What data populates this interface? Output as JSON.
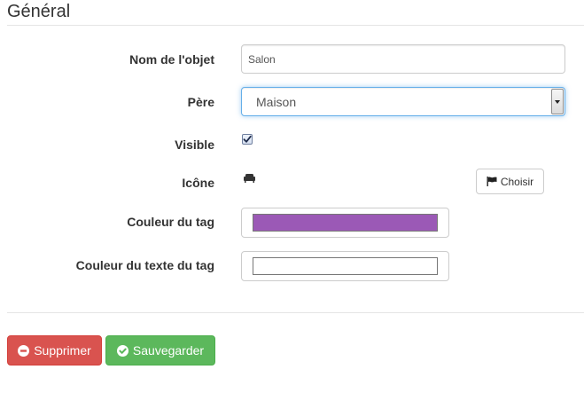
{
  "section": {
    "title": "Général"
  },
  "form": {
    "name": {
      "label": "Nom de l'objet",
      "value": "Salon"
    },
    "parent": {
      "label": "Père",
      "selected": "Maison"
    },
    "visible": {
      "label": "Visible",
      "checked": true
    },
    "icon": {
      "label": "Icône",
      "current_icon": "sofa-icon",
      "choose_label": "Choisir",
      "choose_icon": "flag-icon"
    },
    "tag_color": {
      "label": "Couleur du tag",
      "value": "#9b59b6"
    },
    "tag_text_color": {
      "label": "Couleur du texte du tag",
      "value": "#ffffff"
    }
  },
  "actions": {
    "delete_label": "Supprimer",
    "delete_icon": "minus-circle-icon",
    "save_label": "Sauvegarder",
    "save_icon": "check-circle-icon"
  },
  "colors": {
    "danger": "#d9534f",
    "success": "#5cb85c",
    "focus": "#66afe9"
  }
}
